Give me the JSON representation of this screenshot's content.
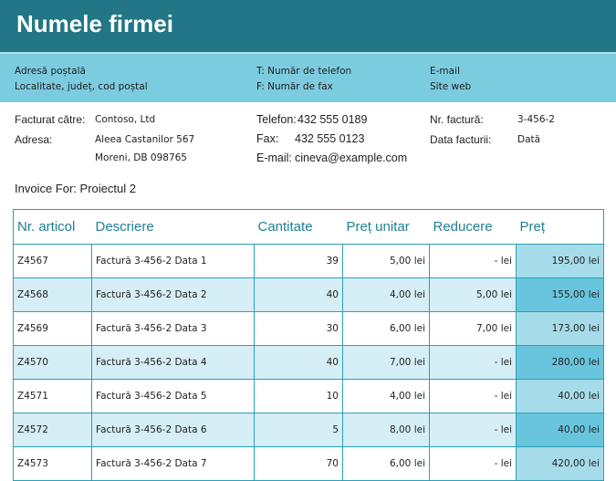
{
  "company_name": "Numele firmei",
  "contact": {
    "address": "Adresă poștală",
    "city": "Localitate, județ, cod poștal",
    "phone": "T: Număr de telefon",
    "fax": "F: Număr de fax",
    "email": "E-mail",
    "website": "Site web"
  },
  "billing": {
    "billed_to_label": "Facturat către:",
    "billed_to_value": "Contoso, Ltd",
    "address_label": "Adresa:",
    "address_line1": "Aleea Castanilor 567",
    "address_line2": "Moreni, DB 098765",
    "phone_label": "Telefon:",
    "phone_value": "432 555 0189",
    "fax_label": "Fax:",
    "fax_value": "432 555 0123",
    "email_label": "E-mail:",
    "email_value": "cineva@example.com",
    "invoice_no_label": "Nr. factură:",
    "invoice_no_value": "3-456-2",
    "invoice_date_label": "Data facturii:",
    "invoice_date_value": "Dată"
  },
  "invoice_for": "Invoice For: Proiectul 2",
  "table": {
    "headers": [
      "Nr. articol",
      "Descriere",
      "Cantitate",
      "Preț unitar",
      "Reducere",
      "Preț"
    ],
    "rows": [
      [
        "Z4567",
        "Factură 3-456-2 Data 1",
        "39",
        "5,00 lei",
        "-     lei",
        "195,00 lei"
      ],
      [
        "Z4568",
        "Factură 3-456-2 Data 2",
        "40",
        "4,00 lei",
        "5,00 lei",
        "155,00 lei"
      ],
      [
        "Z4569",
        "Factură 3-456-2 Data 3",
        "30",
        "6,00 lei",
        "7,00 lei",
        "173,00 lei"
      ],
      [
        "Z4570",
        "Factură 3-456-2 Data 4",
        "40",
        "7,00 lei",
        "-     lei",
        "280,00 lei"
      ],
      [
        "Z4571",
        "Factură 3-456-2 Data 5",
        "10",
        "4,00 lei",
        "-     lei",
        "40,00 lei"
      ],
      [
        "Z4572",
        "Factură 3-456-2 Data 6",
        "5",
        "8,00 lei",
        "-     lei",
        "40,00 lei"
      ],
      [
        "Z4573",
        "Factură 3-456-2 Data 7",
        "70",
        "6,00 lei",
        "-     lei",
        "420,00 lei"
      ]
    ]
  },
  "colors": {
    "title_bar": "#227686",
    "contact_bar": "#7ccce0",
    "accent_text": "#1d7f95",
    "row_alt": "#d6eef5",
    "price_col_light": "#a6dcea",
    "price_col_dark": "#69c5dd"
  }
}
